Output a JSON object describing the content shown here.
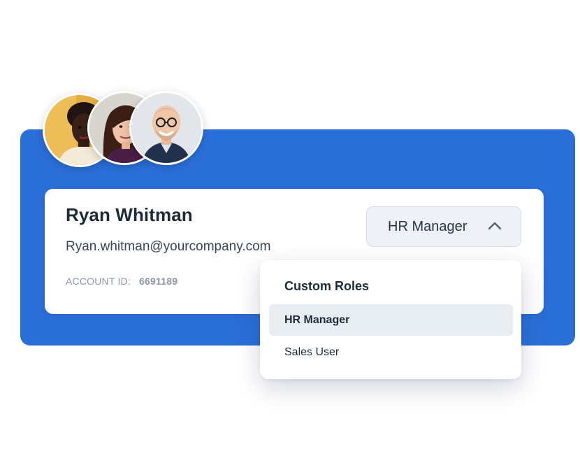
{
  "user": {
    "name": "Ryan Whitman",
    "email": "Ryan.whitman@yourcompany.com",
    "account_id_label": "ACCOUNT ID:",
    "account_id": "6691189"
  },
  "role_select": {
    "selected": "HR Manager",
    "expanded": true
  },
  "dropdown": {
    "group_title": "Custom Roles",
    "items": [
      {
        "label": "HR Manager",
        "selected": true
      },
      {
        "label": "Sales User",
        "selected": false
      }
    ]
  },
  "avatars": [
    {
      "name": "avatar-woman-short-hair",
      "bg": "#e0a93a"
    },
    {
      "name": "avatar-woman-long-hair",
      "bg": "#d6d2cc"
    },
    {
      "name": "avatar-man-glasses",
      "bg": "#dfe3e7"
    }
  ],
  "colors": {
    "accent": "#2a6fd8",
    "menu_selected_bg": "#e8edf2"
  }
}
